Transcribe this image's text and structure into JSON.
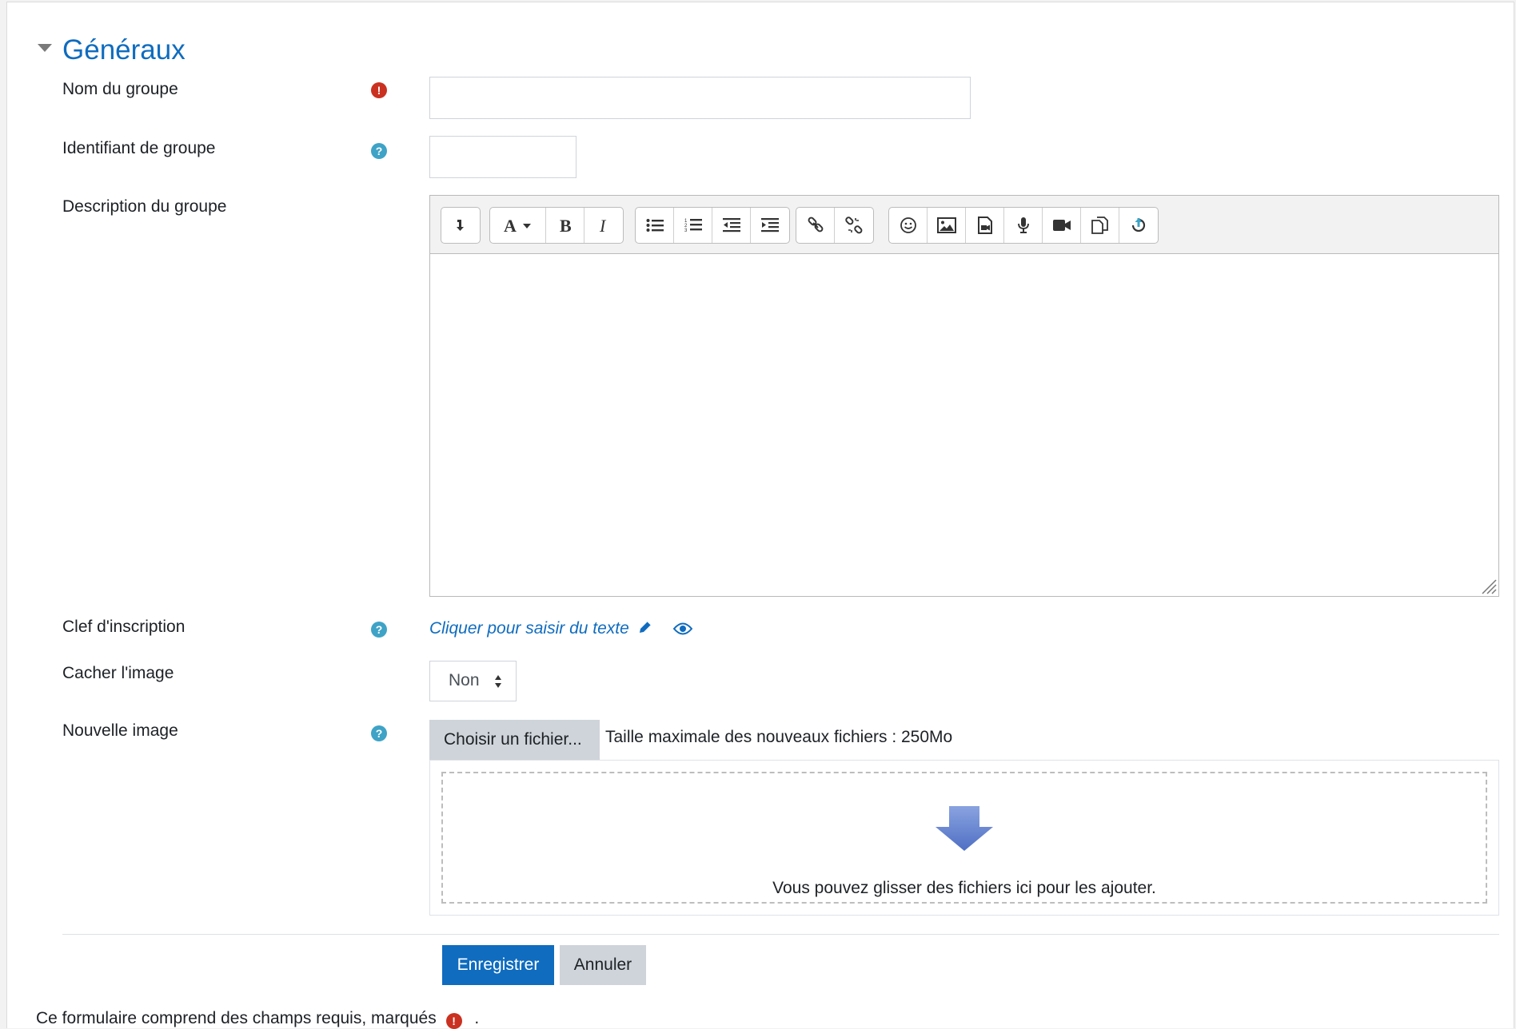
{
  "section": {
    "title": "Généraux"
  },
  "fields": {
    "group_name": {
      "label": "Nom du groupe",
      "value": ""
    },
    "group_id": {
      "label": "Identifiant de groupe",
      "value": ""
    },
    "description": {
      "label": "Description du groupe"
    },
    "enrolment_key": {
      "label": "Clef d'inscription",
      "link_text": "Cliquer pour saisir du texte"
    },
    "hide_picture": {
      "label": "Cacher l'image",
      "selected": "Non"
    },
    "new_picture": {
      "label": "Nouvelle image",
      "choose_button": "Choisir un fichier...",
      "max_size": "Taille maximale des nouveaux fichiers : 250Mo",
      "drop_text": "Vous pouvez glisser des fichiers ici pour les ajouter."
    }
  },
  "toolbar": {
    "icons": [
      "collapse-icon",
      "font-color-icon",
      "bold-icon",
      "italic-icon",
      "unordered-list-icon",
      "ordered-list-icon",
      "outdent-icon",
      "indent-icon",
      "link-icon",
      "unlink-icon",
      "emoji-icon",
      "image-icon",
      "media-icon",
      "record-audio-icon",
      "record-video-icon",
      "manage-files-icon",
      "h5p-icon"
    ]
  },
  "buttons": {
    "save": "Enregistrer",
    "cancel": "Annuler"
  },
  "footer": {
    "note": "Ce formulaire comprend des champs requis, marqués",
    "suffix": "."
  },
  "colors": {
    "primary": "#0f6cbf",
    "required": "#ca3120",
    "help": "#3ea3c6"
  }
}
